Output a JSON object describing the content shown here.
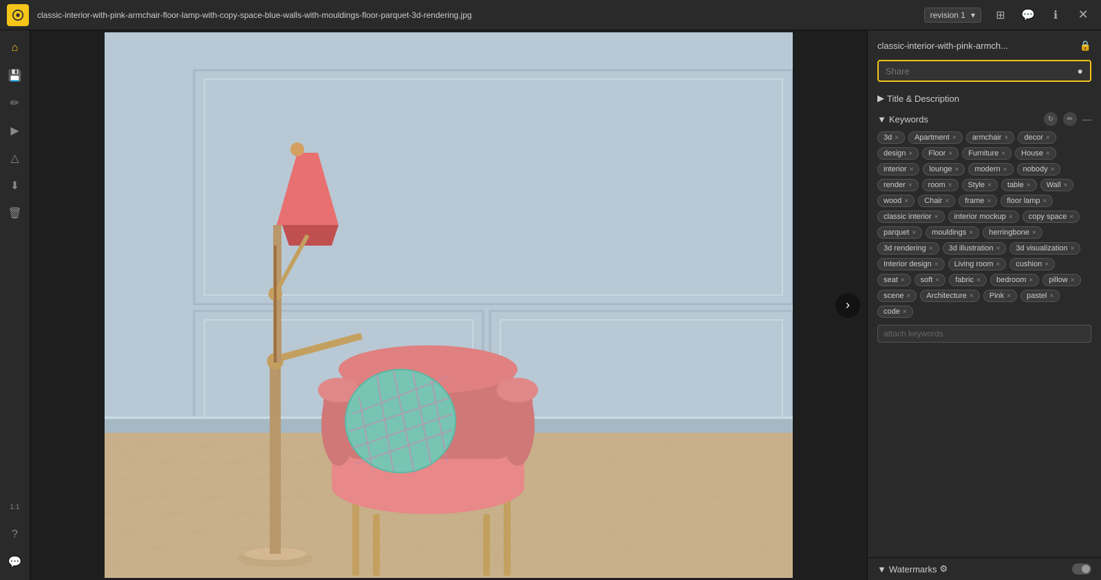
{
  "topbar": {
    "filename": "classic-interior-with-pink-armchair-floor-lamp-with-copy-space-blue-walls-with-mouldings-floor-parquet-3d-rendering.jpg",
    "revision_label": "revision 1",
    "chevron": "▾",
    "icon_grid": "⊞",
    "icon_chat": "💬",
    "icon_info": "ℹ",
    "icon_close": "✕"
  },
  "left_sidebar": {
    "icons": [
      {
        "name": "home-icon",
        "symbol": "⌂"
      },
      {
        "name": "save-icon",
        "symbol": "💾"
      },
      {
        "name": "edit-icon",
        "symbol": "✏"
      },
      {
        "name": "send-icon",
        "symbol": "▶"
      },
      {
        "name": "warning-icon",
        "symbol": "△"
      },
      {
        "name": "download-icon",
        "symbol": "⬇"
      },
      {
        "name": "trash-icon",
        "symbol": "🗑"
      },
      {
        "name": "ratio-icon",
        "symbol": "1:1"
      },
      {
        "name": "help-icon",
        "symbol": "?"
      },
      {
        "name": "comment-icon",
        "symbol": "💬"
      }
    ]
  },
  "right_panel": {
    "file_title": "classic-interior-with-pink-armch...",
    "share_placeholder": "Share",
    "share_icon": "●",
    "title_description_label": "Title & Description",
    "keywords_label": "Keywords",
    "keywords_refresh_icon": "↻",
    "keywords_edit_icon": "✏",
    "tags": [
      "3d",
      "Apartment",
      "armchair",
      "decor",
      "design",
      "Floor",
      "Furniture",
      "House",
      "interior",
      "lounge",
      "modern",
      "nobody",
      "render",
      "room",
      "Style",
      "table",
      "Wall",
      "wood",
      "Chair",
      "frame",
      "floor lamp",
      "classic interior",
      "interior mockup",
      "copy space",
      "parquet",
      "mouldings",
      "herringbone",
      "3d rendering",
      "3d illustration",
      "3d visualization",
      "Interior design",
      "Living room",
      "cushion",
      "seat",
      "soft",
      "fabric",
      "bedroom",
      "pillow",
      "scene",
      "Architecture",
      "Pink",
      "pastel",
      "code"
    ],
    "keyword_input_placeholder": "attach keywords",
    "watermarks_label": "Watermarks",
    "watermarks_gear": "⚙",
    "watermarks_toggle": false
  },
  "image": {
    "nav_arrow": "›",
    "ratio_label": "1:1"
  }
}
